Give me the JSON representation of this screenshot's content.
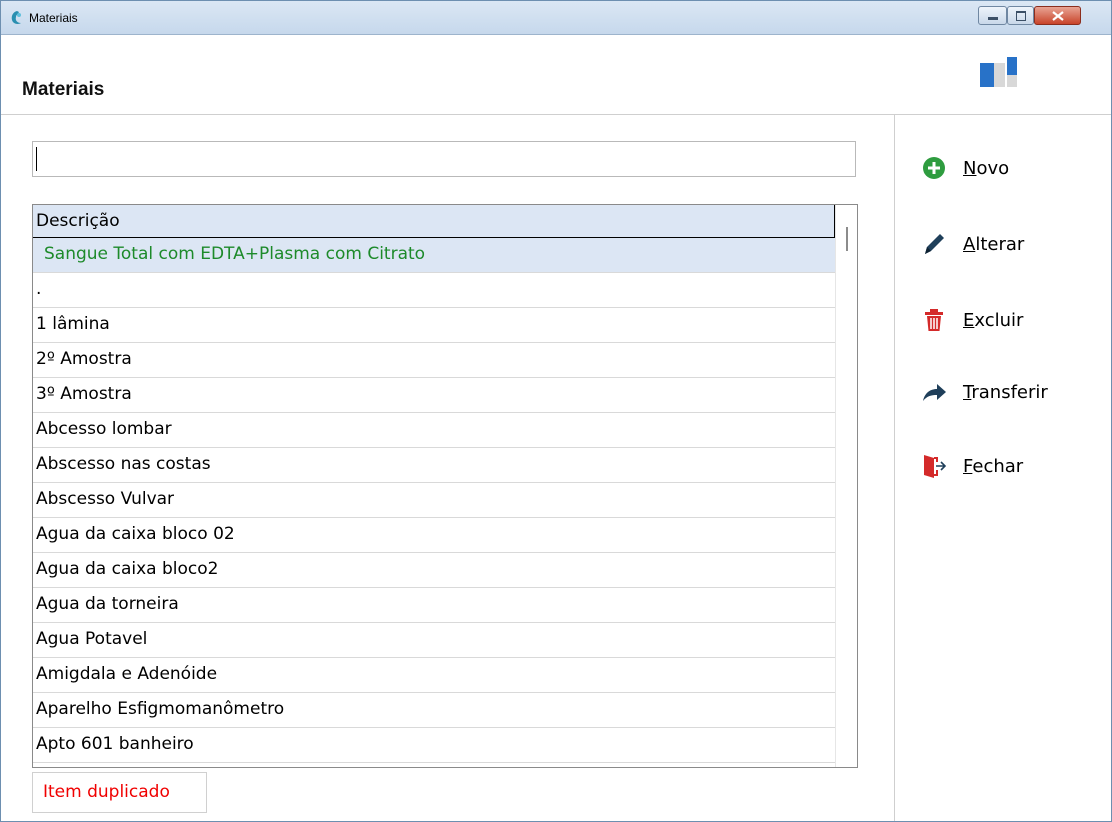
{
  "window": {
    "title": "Materiais"
  },
  "header": {
    "title": "Materiais"
  },
  "search": {
    "value": "",
    "placeholder": ""
  },
  "grid": {
    "column_header": "Descrição",
    "rows": [
      "Sangue Total com EDTA+Plasma com Citrato",
      ".",
      "1 lâmina",
      "2º Amostra",
      "3º Amostra",
      "Abcesso lombar",
      "Abscesso nas costas",
      "Abscesso Vulvar",
      "Agua da caixa bloco 02",
      "Agua da caixa bloco2",
      "Agua da torneira",
      "Agua Potavel",
      "Amigdala e Adenóide",
      "Aparelho Esfigmomanômetro",
      "Apto 601 banheiro"
    ],
    "selected_index": 0
  },
  "status": {
    "message": "Item duplicado",
    "color": "#f00000"
  },
  "actions": [
    {
      "key": "N",
      "rest": "ovo",
      "icon": "add-circle-icon"
    },
    {
      "key": "A",
      "rest": "lterar",
      "icon": "pencil-icon"
    },
    {
      "key": "E",
      "rest": "xcluir",
      "icon": "trash-icon"
    },
    {
      "key": "T",
      "rest": "ransferir",
      "icon": "share-arrow-icon"
    },
    {
      "key": "F",
      "rest": "echar",
      "icon": "exit-door-icon"
    }
  ],
  "colors": {
    "selected_text": "#1d8a2a",
    "selected_bg": "#dce6f4",
    "accent_green": "#2e9c3f",
    "accent_red": "#d42a2a"
  }
}
